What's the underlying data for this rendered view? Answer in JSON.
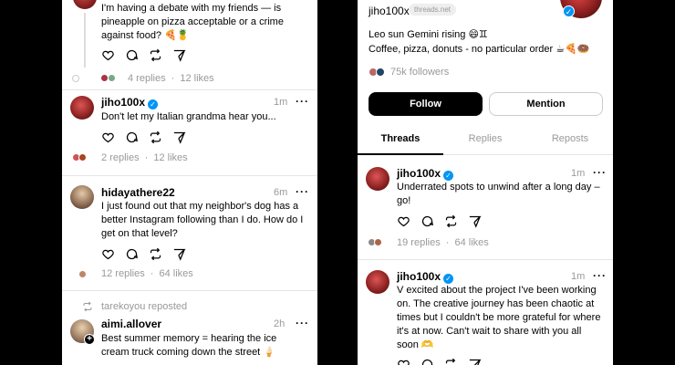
{
  "left": {
    "post1": {
      "body": "I'm having a debate with my friends — is pineapple on pizza acceptable or a crime against food? 🍕🍍",
      "replies": "4 replies",
      "likes": "12 likes",
      "sep": "·"
    },
    "post2": {
      "username": "jiho100x",
      "time": "1m",
      "body": "Don't let my Italian grandma hear you...",
      "replies": "2 replies",
      "likes": "12 likes",
      "sep": "·"
    },
    "post3": {
      "username": "hidayathere22",
      "time": "6m",
      "body": "I just found out that my neighbor's dog has a better Instagram following than I do. How do I get on that level?",
      "replies": "12 replies",
      "likes": "64 likes",
      "sep": "·"
    },
    "repost_label": "tarekoyou reposted",
    "post4": {
      "username": "aimi.allover",
      "time": "2h",
      "body": "Best summer memory = hearing the ice cream truck coming down the street 🍦"
    }
  },
  "right": {
    "profile": {
      "handle": "jiho100x",
      "domain_badge": "threads.net",
      "bio_line1": "Leo sun Gemini rising 😄♊",
      "bio_line2": "Coffee, pizza, donuts - no particular order ☕🍕🍩",
      "followers": "75k followers"
    },
    "buttons": {
      "follow": "Follow",
      "mention": "Mention"
    },
    "tabs": [
      "Threads",
      "Replies",
      "Reposts"
    ],
    "post1": {
      "username": "jiho100x",
      "time": "1m",
      "body": "Underrated spots to unwind after a long day – go!",
      "replies": "19 replies",
      "likes": "64 likes",
      "sep": "·"
    },
    "post2": {
      "username": "jiho100x",
      "time": "1m",
      "body": "V excited about the project I've been working on. The creative journey has been chaotic at times but I couldn't be more grateful for where it's at now. Can't wait to share with you all soon 🫶"
    }
  },
  "colors": {
    "verified": "#0095f6",
    "muted": "#999999",
    "follow_bg": "#000000"
  }
}
